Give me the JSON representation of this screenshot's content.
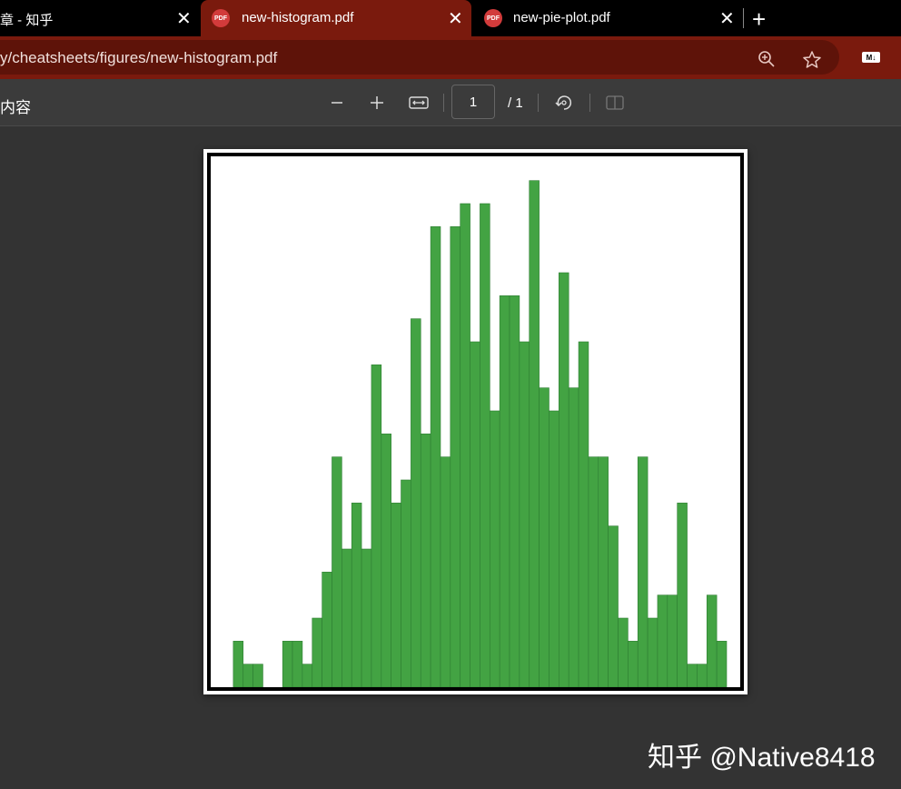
{
  "browser": {
    "tabs": [
      {
        "label": "章 - 知乎",
        "active": false
      },
      {
        "label": "new-histogram.pdf",
        "active": true,
        "icon": "pdf-icon"
      },
      {
        "label": "new-pie-plot.pdf",
        "active": false,
        "icon": "pdf-icon"
      }
    ],
    "address": "y/cheatsheets/figures/new-histogram.pdf",
    "md_badge": "M↓"
  },
  "pdf_toolbar": {
    "left_text": "内容",
    "page_current": "1",
    "page_total": "/ 1"
  },
  "watermark": "知乎 @Native8418",
  "chart_data": {
    "type": "bar",
    "title": "",
    "xlabel": "",
    "ylabel": "",
    "bar_color": "#43a343",
    "edge_color": "#2e7d32",
    "ylim": [
      0,
      22.5
    ],
    "values": [
      0,
      2,
      1,
      1,
      0,
      0,
      2,
      2,
      1,
      3,
      5,
      10,
      6,
      8,
      6,
      14,
      11,
      8,
      9,
      16,
      11,
      20,
      10,
      20,
      21,
      15,
      21,
      12,
      17,
      17,
      15,
      22,
      13,
      12,
      18,
      13,
      15,
      10,
      10,
      7,
      3,
      2,
      10,
      3,
      4,
      4,
      8,
      1,
      1,
      4,
      2
    ]
  }
}
